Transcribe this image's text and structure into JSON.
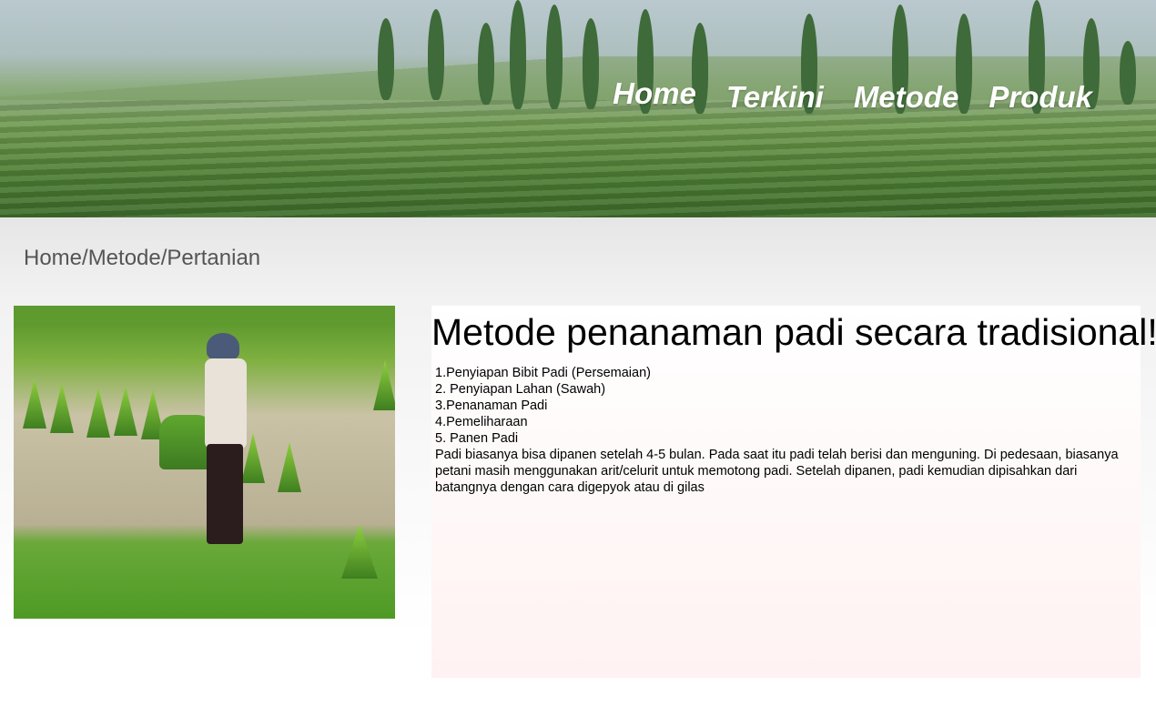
{
  "header": {
    "nav": [
      {
        "label": "Home"
      },
      {
        "label": "Terkini"
      },
      {
        "label": "Metode"
      },
      {
        "label": "Produk"
      }
    ]
  },
  "breadcrumb": "Home/Metode/Pertanian",
  "article": {
    "title": "Metode penanaman padi secara tradisional!",
    "steps": [
      "1.Penyiapan Bibit Padi (Persemaian)",
      "2. Penyiapan Lahan (Sawah)",
      "3.Penanaman Padi",
      "4.Pemeliharaan",
      "5.  Panen Padi"
    ],
    "paragraph": " Padi biasanya bisa dipanen setelah 4-5 bulan. Pada saat itu padi telah berisi dan menguning. Di pedesaan, biasanya petani masih menggunakan arit/celurit untuk memotong padi. Setelah dipanen, padi kemudian dipisahkan dari batangnya dengan cara digepyok atau di gilas"
  },
  "colors": {
    "nav_text": "#ffffff",
    "breadcrumb_text": "#555555",
    "article_bg_top": "#ffffff",
    "article_bg_bottom": "#fff2f2"
  }
}
